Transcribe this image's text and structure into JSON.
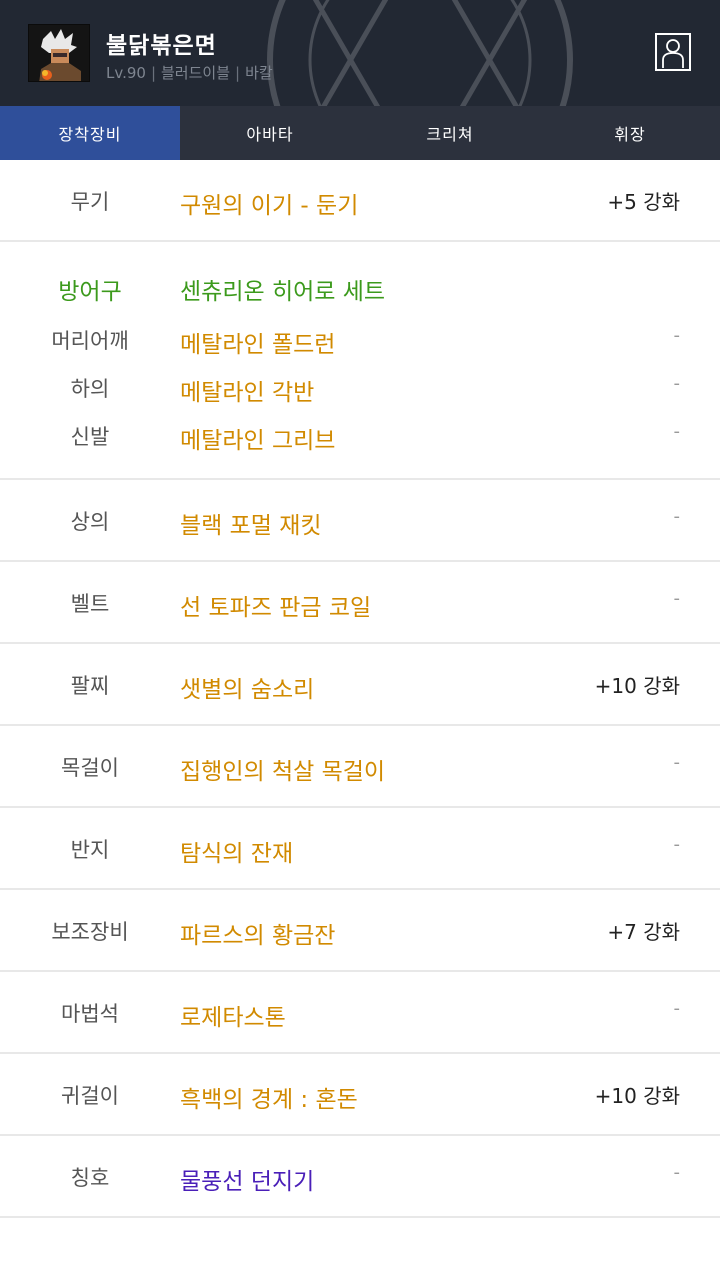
{
  "character": {
    "name": "불닭볶은면",
    "level": "Lv.90",
    "class": "블러드이블",
    "server": "바칼"
  },
  "tabs": [
    {
      "label": "장착장비",
      "active": true
    },
    {
      "label": "아바타",
      "active": false
    },
    {
      "label": "크리쳐",
      "active": false
    },
    {
      "label": "휘장",
      "active": false
    }
  ],
  "colors": {
    "header_bg": "#222833",
    "active_tab": "#2f4f9a",
    "item_unique": "#d18a00",
    "set_green": "#3c9a1c",
    "title_purple": "#4a1fb8"
  },
  "equipment": {
    "weapon": {
      "slot": "무기",
      "item": "구원의 이기 - 둔기",
      "enhance": "+5 강화"
    },
    "armor": {
      "slot": "방어구",
      "set_name": "센츄리온 히어로 세트",
      "pieces": [
        {
          "slot": "머리어깨",
          "item": "메탈라인 폴드런",
          "enhance": "-"
        },
        {
          "slot": "하의",
          "item": "메탈라인 각반",
          "enhance": "-"
        },
        {
          "slot": "신발",
          "item": "메탈라인 그리브",
          "enhance": "-"
        }
      ]
    },
    "rows": [
      {
        "slot": "상의",
        "item": "블랙 포멀 재킷",
        "enhance": "-"
      },
      {
        "slot": "벨트",
        "item": "선 토파즈 판금 코일",
        "enhance": "-"
      },
      {
        "slot": "팔찌",
        "item": "샛별의 숨소리",
        "enhance": "+10 강화"
      },
      {
        "slot": "목걸이",
        "item": "집행인의 척살 목걸이",
        "enhance": "-"
      },
      {
        "slot": "반지",
        "item": "탐식의 잔재",
        "enhance": "-"
      },
      {
        "slot": "보조장비",
        "item": "파르스의 황금잔",
        "enhance": "+7 강화"
      },
      {
        "slot": "마법석",
        "item": "로제타스톤",
        "enhance": "-"
      },
      {
        "slot": "귀걸이",
        "item": "흑백의 경계 : 혼돈",
        "enhance": "+10 강화"
      },
      {
        "slot": "칭호",
        "item": "물풍선 던지기",
        "enhance": "-"
      }
    ]
  }
}
